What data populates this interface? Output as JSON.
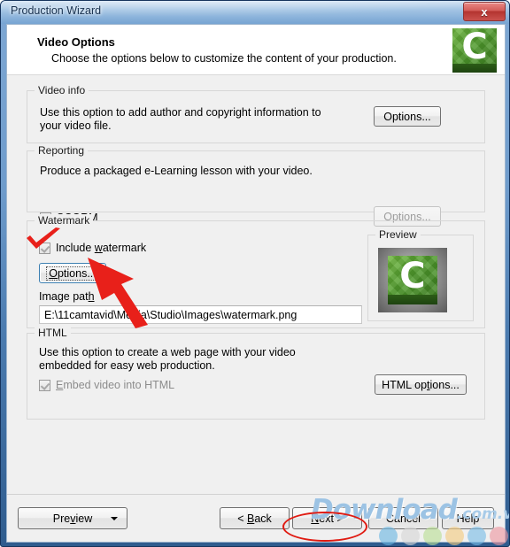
{
  "window": {
    "title": "Production Wizard",
    "close_label": "x",
    "close_icon": "close-icon"
  },
  "header": {
    "title": "Video Options",
    "subtitle": "Choose the options below to customize the content of your production.",
    "logo_icon": "camtasia-logo-icon",
    "logo_letter": "C"
  },
  "groups": {
    "video_info": {
      "legend": "Video info",
      "description": "Use this option to add author and copyright information to your video file.",
      "options_button": "Options..."
    },
    "reporting": {
      "legend": "Reporting",
      "description": "Produce a packaged e-Learning lesson with your video.",
      "scorm_label": "SCORM",
      "scorm_checked": false,
      "options_button": "Options...",
      "options_disabled": true
    },
    "watermark": {
      "legend": "Watermark",
      "include_label": "Include watermark",
      "include_checked": true,
      "options_button": "Options...",
      "image_path_label": "Image path",
      "image_path_value": "E:\\11camtavid\\Media\\Studio\\Images\\watermark.png",
      "preview_legend": "Preview",
      "preview_icon": "camtasia-watermark-thumbnail",
      "preview_letter": "C"
    },
    "html": {
      "legend": "HTML",
      "description": "Use this option to create a web page with your video embedded for easy web production.",
      "embed_label": "Embed video into HTML",
      "embed_checked": true,
      "embed_disabled": true,
      "options_button": "HTML options..."
    }
  },
  "footer": {
    "preview_button": "Preview",
    "preview_dropdown_icon": "chevron-down-icon",
    "back_button": "< Back",
    "next_button": "Next >",
    "cancel_button": "Cancel",
    "help_button": "Help"
  },
  "annotations": {
    "checkmark": "red-checkmark-on-include-watermark",
    "arrow": "red-arrow-pointing-to-watermark-options-button",
    "oval": "red-oval-around-next-button"
  },
  "watermark_overlay": {
    "main_text": "Download",
    "sub_text": ".com.vn",
    "dot_colors": [
      "#7ec0e8",
      "#d9d9d9",
      "#bfe09a",
      "#f5cf86",
      "#8fc4e8",
      "#efa0a8"
    ]
  }
}
